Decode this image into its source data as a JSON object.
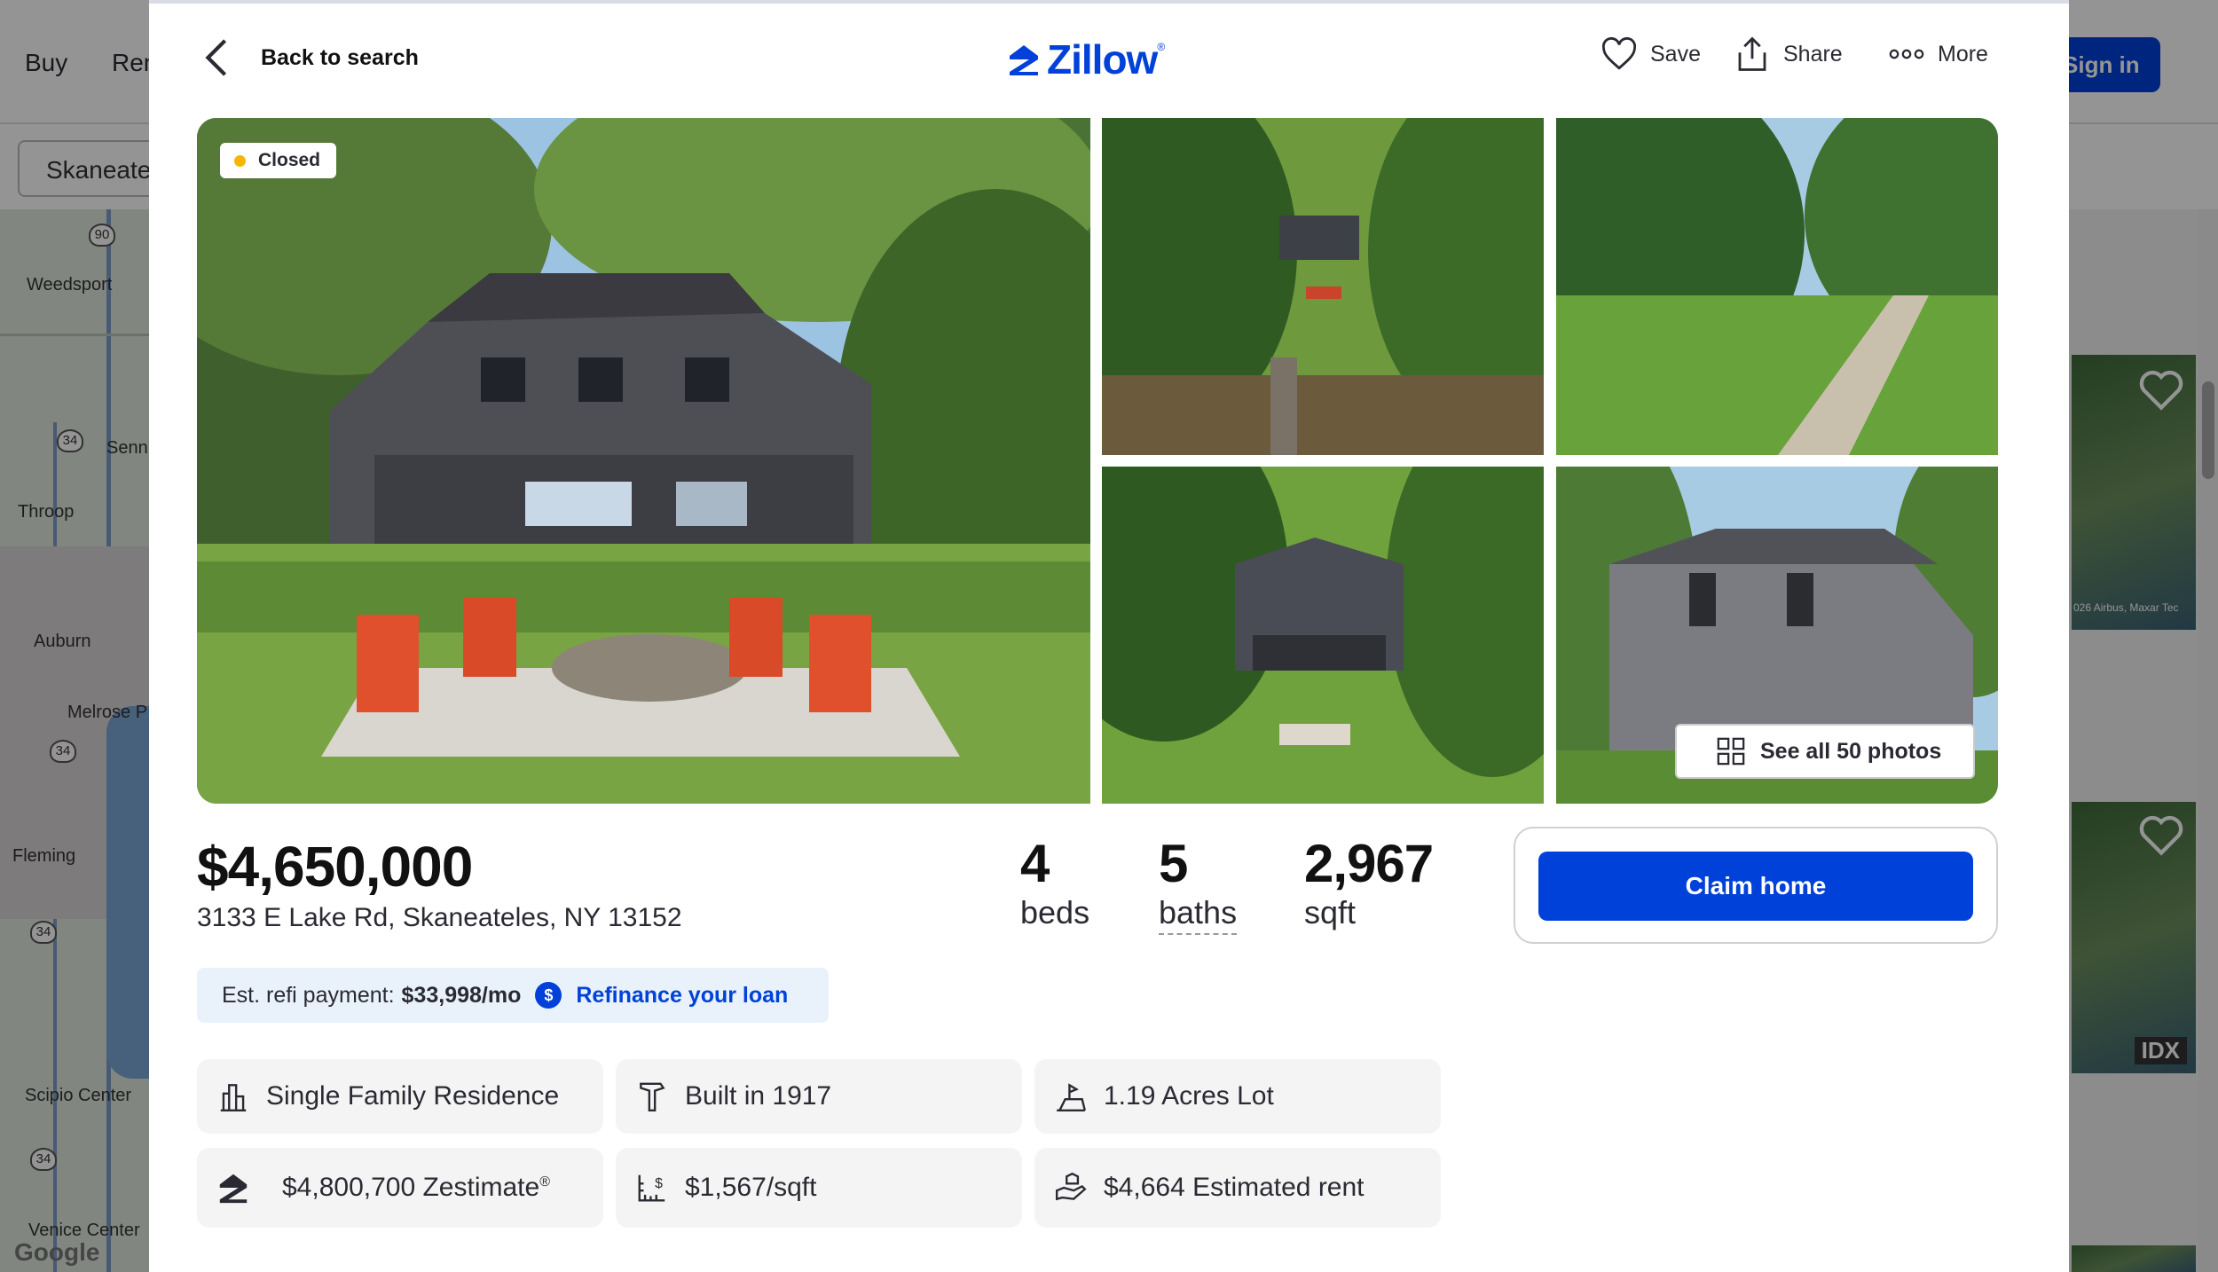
{
  "background": {
    "nav": [
      "Buy",
      "Ren"
    ],
    "sign_in": "Sign in",
    "search_value": "Skaneate",
    "map_labels": [
      "Weedsport",
      "Senn",
      "Throop",
      "Auburn",
      "Melrose P",
      "Fleming",
      "Scipio Center",
      "Venice Center"
    ],
    "map_shields": [
      "90",
      "34",
      "34",
      "34",
      "34"
    ],
    "map_attribution": "Google",
    "right_attribution": "026 Airbus, Maxar Tec",
    "idx_label": "IDX"
  },
  "header": {
    "back_label": "Back to search",
    "logo_text": "Zillow",
    "logo_mark": "®",
    "save_label": "Save",
    "share_label": "Share",
    "more_label": "More"
  },
  "gallery": {
    "status_badge": "Closed",
    "see_all_label": "See all 50 photos"
  },
  "listing": {
    "price": "$4,650,000",
    "address": "3133 E Lake Rd, Skaneateles, NY 13152",
    "beds_value": "4",
    "beds_label": "beds",
    "baths_value": "5",
    "baths_label": "baths",
    "sqft_value": "2,967",
    "sqft_label": "sqft",
    "claim_label": "Claim home"
  },
  "refi": {
    "prefix": "Est. refi payment:",
    "amount": "$33,998/mo",
    "icon_glyph": "$",
    "link": "Refinance your loan"
  },
  "facts": {
    "type": "Single Family Residence",
    "built": "Built in 1917",
    "lot": "1.19 Acres Lot",
    "zestimate": "$4,800,700 Zestimate",
    "zestimate_mark": "®",
    "price_per_sqft": "$1,567/sqft",
    "rent": "$4,664 Estimated rent"
  },
  "colors": {
    "brand_blue": "#0041d9",
    "badge_dot": "#f5b700",
    "refi_bg": "#e9f2fb",
    "fact_bg": "#f4f4f4"
  }
}
